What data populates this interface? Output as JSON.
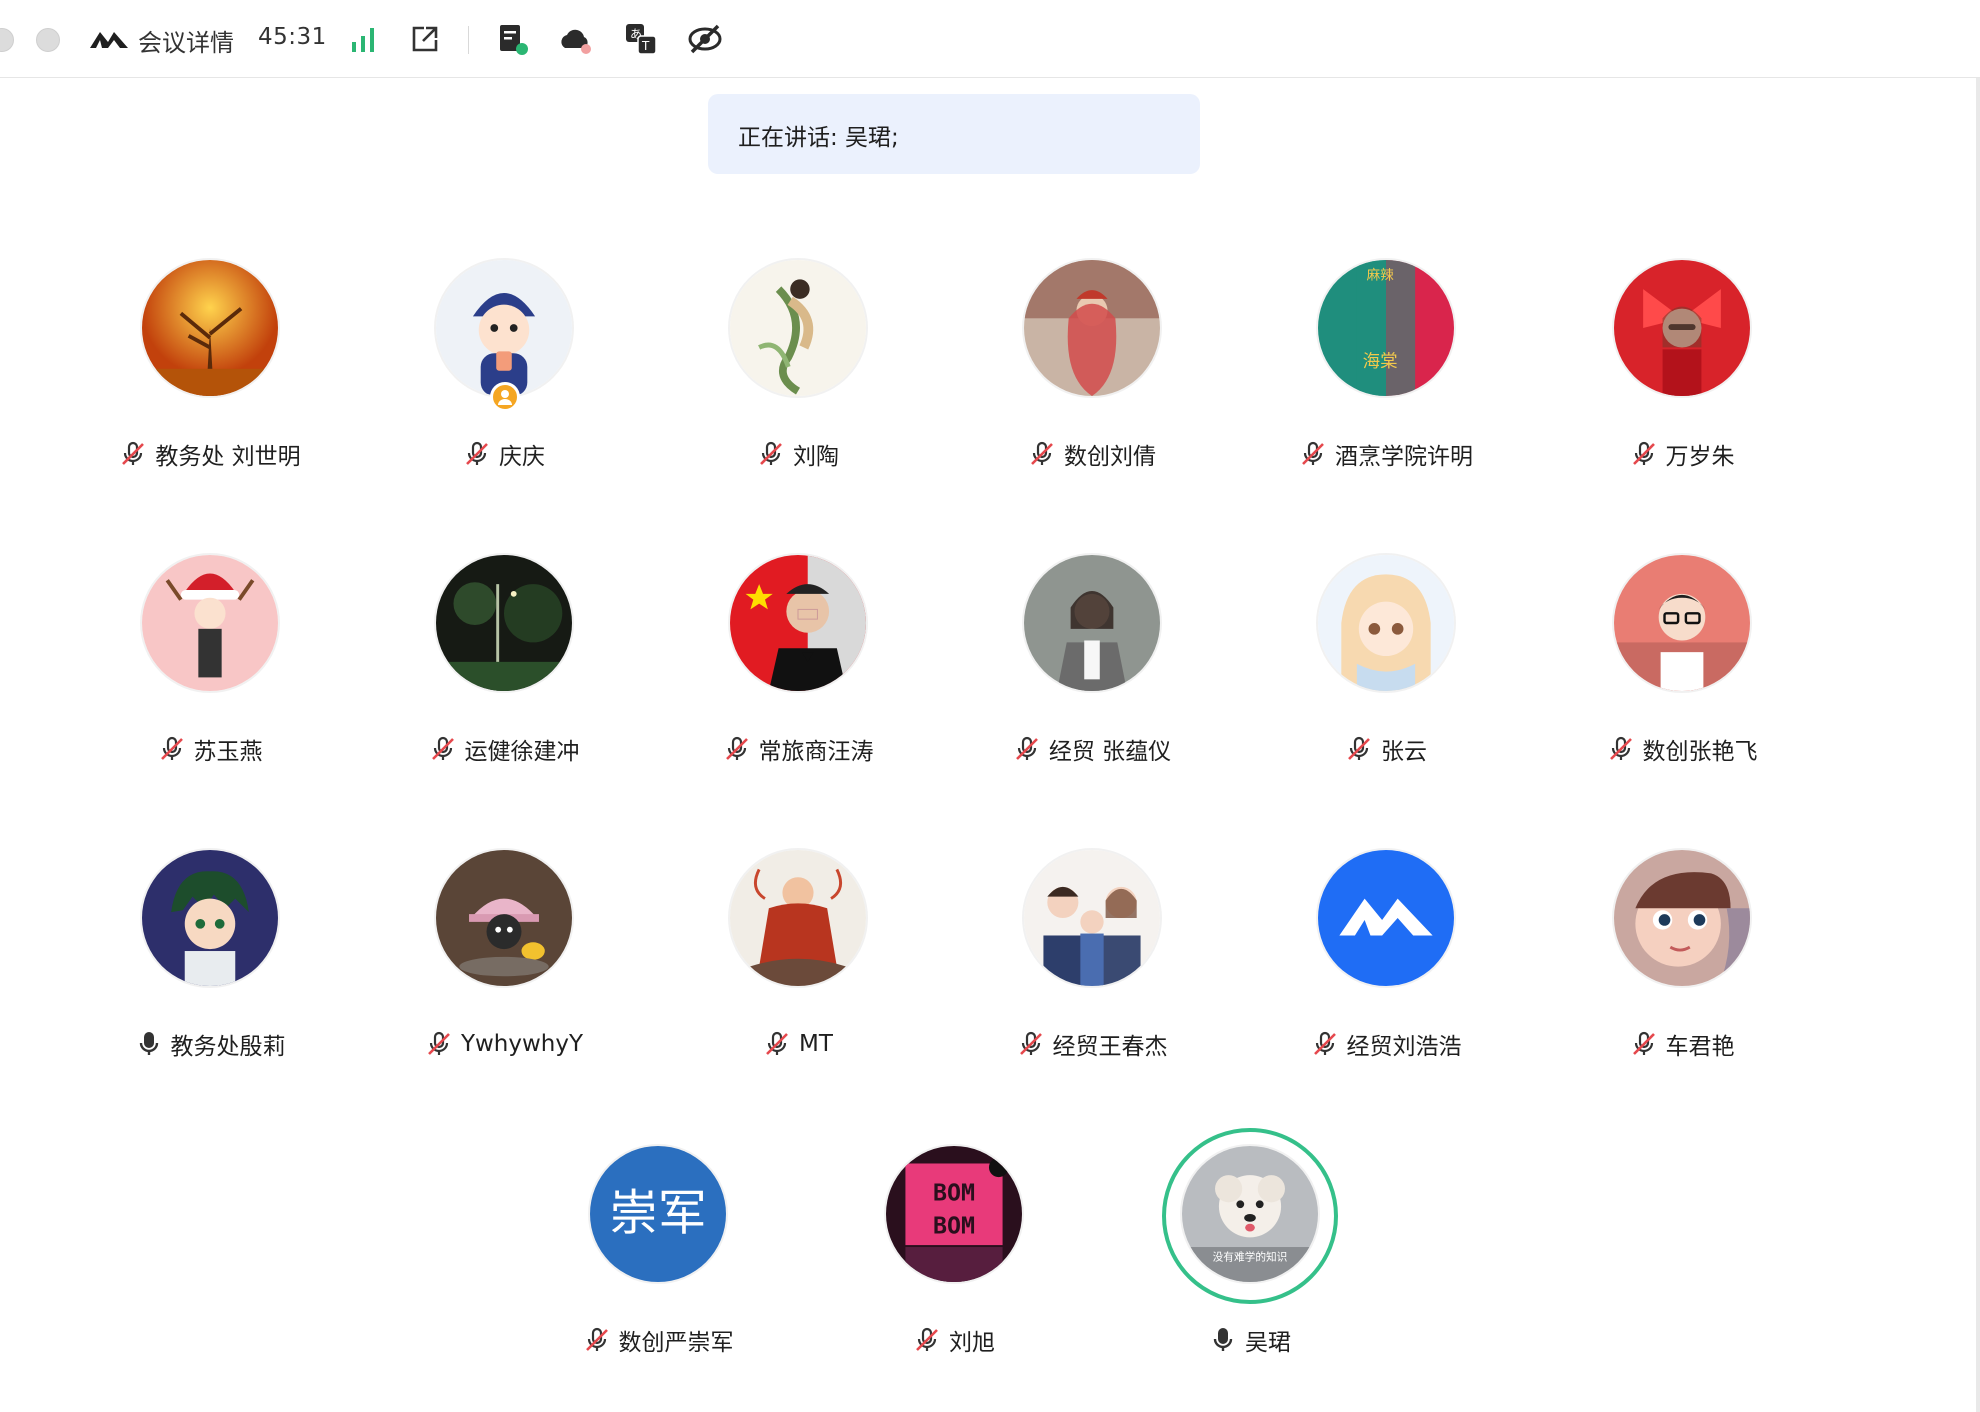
{
  "toolbar": {
    "title": "会议详情",
    "timer": "45:31",
    "icons": [
      "meeting-logo-icon",
      "signal-strength-icon",
      "share-out-icon",
      "document-icon",
      "cloud-record-icon",
      "translate-icon",
      "hide-view-icon"
    ]
  },
  "banner": {
    "text": "正在讲话: 吴珺;"
  },
  "participants": [
    {
      "name": "教务处 刘世明",
      "mic": "muted",
      "avatar": "autumn-tree"
    },
    {
      "name": "庆庆",
      "mic": "muted",
      "avatar": "cartoon-child",
      "host": true
    },
    {
      "name": "刘陶",
      "mic": "muted",
      "avatar": "ink-painting"
    },
    {
      "name": "数创刘倩",
      "mic": "muted",
      "avatar": "photo-woman-red"
    },
    {
      "name": "酒烹学院许明",
      "mic": "muted",
      "avatar": "teal-red-poster"
    },
    {
      "name": "万岁朱",
      "mic": "muted",
      "avatar": "red-bow-girl"
    },
    {
      "name": "苏玉燕",
      "mic": "muted",
      "avatar": "christmas-hat-girl"
    },
    {
      "name": "运健徐建冲",
      "mic": "muted",
      "avatar": "night-park"
    },
    {
      "name": "常旅商汪涛",
      "mic": "muted",
      "avatar": "flag-man"
    },
    {
      "name": "经贸 张蕴仪",
      "mic": "muted",
      "avatar": "photo-woman-blazer"
    },
    {
      "name": "张云",
      "mic": "muted",
      "avatar": "anime-girl"
    },
    {
      "name": "数创张艳飞",
      "mic": "muted",
      "avatar": "cartoon-man-glasses"
    },
    {
      "name": "教务处殷莉",
      "mic": "on",
      "avatar": "anime-boy"
    },
    {
      "name": "YwhywhyY",
      "mic": "muted",
      "avatar": "toy-duck"
    },
    {
      "name": "MT",
      "mic": "muted",
      "avatar": "monk-painting"
    },
    {
      "name": "经贸王春杰",
      "mic": "muted",
      "avatar": "family-cartoon"
    },
    {
      "name": "经贸刘浩浩",
      "mic": "muted",
      "avatar": "app-logo-blue"
    },
    {
      "name": "车君艳",
      "mic": "muted",
      "avatar": "doll-face"
    },
    {
      "name": "数创严崇军",
      "mic": "muted",
      "avatar": "text-avatar",
      "avatar_text": "崇军"
    },
    {
      "name": "刘旭",
      "mic": "muted",
      "avatar": "bombom-card"
    },
    {
      "name": "吴珺",
      "mic": "on",
      "avatar": "white-puppy",
      "speaking": true,
      "avatar_caption": "没有难学的知识"
    }
  ],
  "colors": {
    "accent_green": "#35c08a",
    "banner_bg": "#ebf1fd",
    "muted_red": "#e5484d",
    "signal_green": "#2bb673",
    "host_orange": "#f5a623"
  }
}
